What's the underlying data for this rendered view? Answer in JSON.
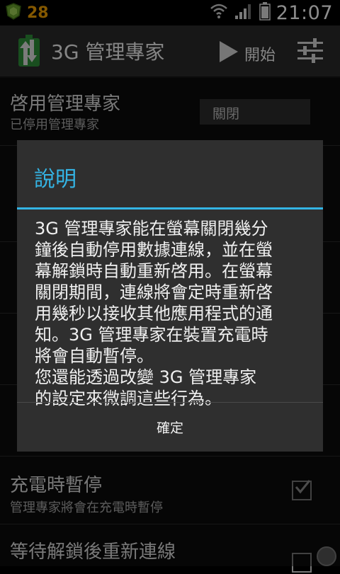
{
  "status": {
    "badge": "28",
    "time": "21:07"
  },
  "actionbar": {
    "title": "3G 管理專家",
    "start_label": "開始"
  },
  "settings": {
    "enable": {
      "title": "啓用管理專家",
      "subtitle": "已停用管理專家",
      "toggle": "關閉"
    },
    "charging": {
      "title": "充電時暫停",
      "subtitle": "管理專家將會在充電時暫停"
    },
    "unlock": {
      "title": "等待解鎖後重新連線"
    }
  },
  "dialog": {
    "title": "說明",
    "message": "3G 管理專家能在螢幕關閉幾分\n鐘後自動停用數據連線，並在螢\n幕解鎖時自動重新啓用。在螢幕\n關閉期間，連線將會定時重新啓\n用幾秒以接收其他應用程式的通\n知。3G 管理專家在裝置充電時\n將會自動暫停。\n您還能透過改變 3G 管理專家\n的設定來微調這些行為。",
    "ok_label": "確定"
  },
  "colors": {
    "accent": "#34b5e5",
    "badge": "#f0a000"
  }
}
